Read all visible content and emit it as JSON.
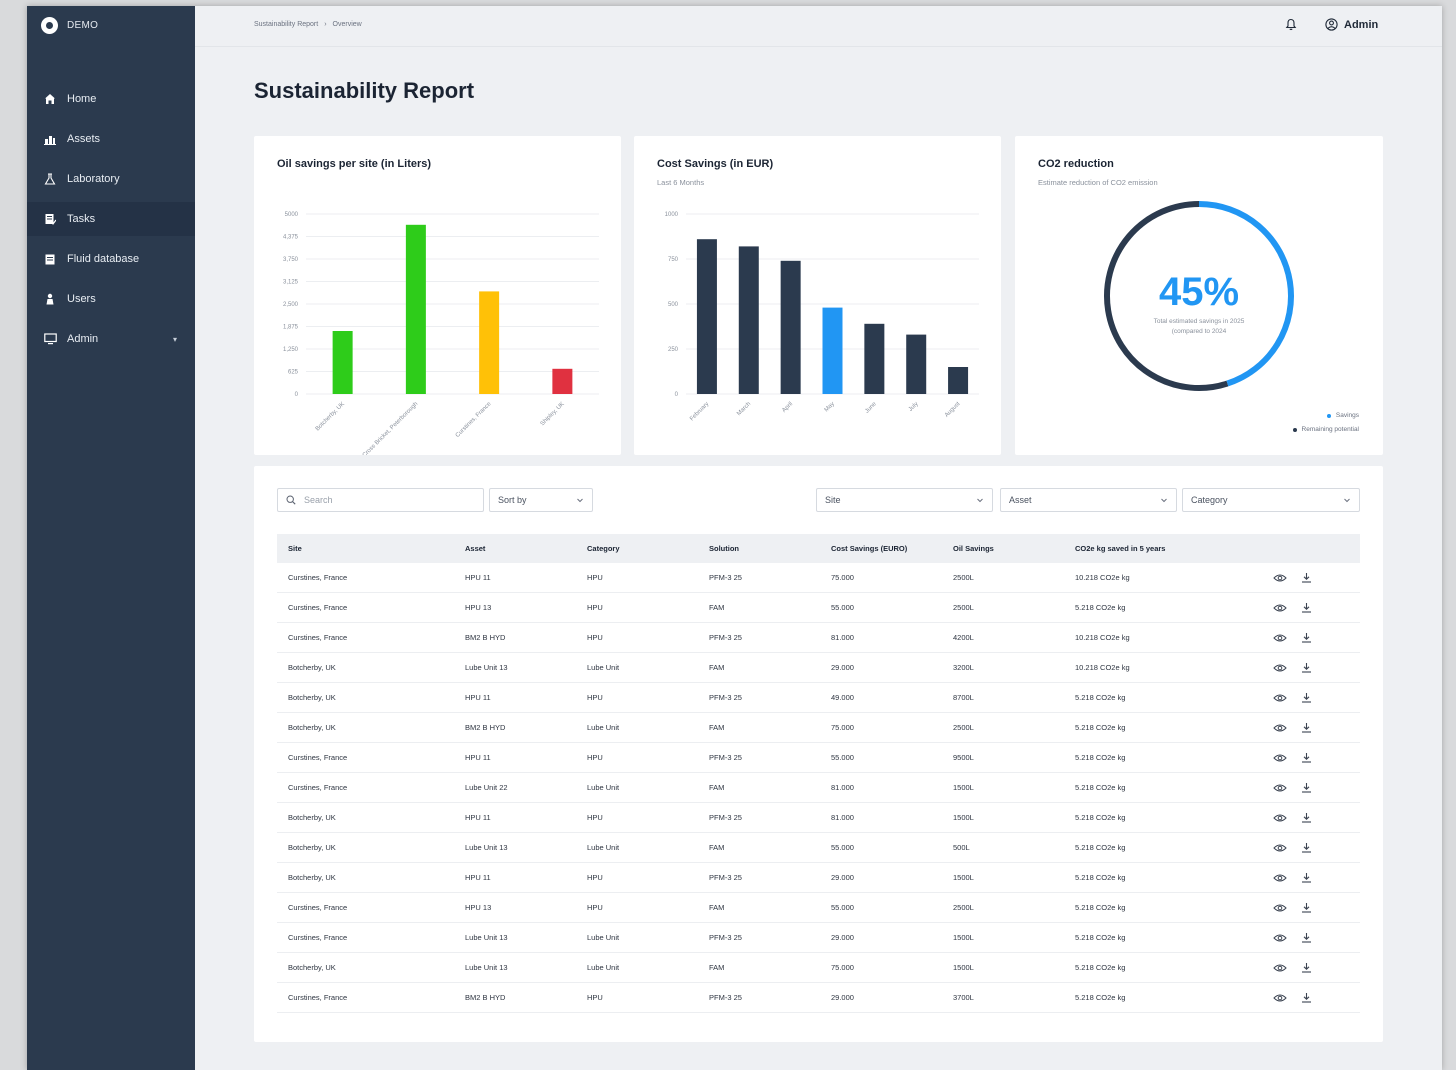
{
  "brand": {
    "name": "DEMO"
  },
  "sidebar": {
    "items": [
      {
        "label": "Home",
        "icon": "home-icon"
      },
      {
        "label": "Assets",
        "icon": "assets-icon"
      },
      {
        "label": "Laboratory",
        "icon": "flask-icon"
      },
      {
        "label": "Tasks",
        "icon": "tasks-icon"
      },
      {
        "label": "Fluid database",
        "icon": "database-icon"
      },
      {
        "label": "Users",
        "icon": "user-icon"
      },
      {
        "label": "Admin",
        "icon": "monitor-icon"
      }
    ],
    "active": "Tasks"
  },
  "breadcrumb": {
    "root": "Sustainability Report",
    "separator": "›",
    "current": "Overview"
  },
  "header": {
    "user": "Admin",
    "icons": [
      "bell-icon",
      "user-circle-icon"
    ]
  },
  "page": {
    "title": "Sustainability Report"
  },
  "colors": {
    "sidebar": "#2b3a4e",
    "accent_blue": "#2196f3",
    "navy": "#2b3a4e",
    "green": "#2ecc1a",
    "yellow": "#ffc107",
    "red": "#e03140"
  },
  "oil_card": {
    "title": "Oil savings per site (in Liters)"
  },
  "cost_card": {
    "title": "Cost Savings (in EUR)",
    "subtitle": "Last 6 Months"
  },
  "co2_card": {
    "title": "CO2 reduction",
    "subtitle": "Estimate reduction of CO2 emission",
    "percent_label": "45%",
    "caption_line1": "Total estimated savings in 2025",
    "caption_line2": "(compared to 2024",
    "legend_savings": "Savings",
    "legend_remaining": "Remaining potential"
  },
  "chart_data": [
    {
      "type": "bar",
      "title": "Oil savings per site (in Liters)",
      "categories": [
        "Botcherby, UK",
        "Cross Bricket, Peterborough",
        "Curstines, France",
        "Shipley, UK"
      ],
      "values": [
        1750,
        4700,
        2850,
        700
      ],
      "bar_colors": [
        "#2ecc1a",
        "#2ecc1a",
        "#ffc107",
        "#e03140"
      ],
      "ylim": [
        0,
        5000
      ],
      "yticks": [
        "0",
        "625",
        "1,250",
        "1,875",
        "2,500",
        "3,125",
        "3,750",
        "4,375",
        "5000"
      ],
      "grid": true
    },
    {
      "type": "bar",
      "title": "Cost Savings (in EUR)",
      "subtitle": "Last 6 Months",
      "categories": [
        "February",
        "March",
        "April",
        "May",
        "June",
        "July",
        "August"
      ],
      "values": [
        860,
        820,
        740,
        480,
        390,
        330,
        150
      ],
      "bar_colors": [
        "#2b3a4e",
        "#2b3a4e",
        "#2b3a4e",
        "#2196f3",
        "#2b3a4e",
        "#2b3a4e",
        "#2b3a4e"
      ],
      "ylim": [
        0,
        1000
      ],
      "yticks": [
        "0",
        "250",
        "500",
        "750",
        "1000"
      ],
      "grid": true
    },
    {
      "type": "pie",
      "title": "CO2 reduction",
      "labels": [
        "Savings",
        "Remaining potential"
      ],
      "values": [
        45,
        55
      ],
      "colors": [
        "#2196f3",
        "#2b3a4e"
      ]
    }
  ],
  "filters": {
    "search_placeholder": "Search",
    "sort_label": "Sort by",
    "site_label": "Site",
    "asset_label": "Asset",
    "category_label": "Category"
  },
  "table": {
    "columns": [
      "Site",
      "Asset",
      "Category",
      "Solution",
      "Cost Savings (EURO)",
      "Oil Savings",
      "CO2e kg saved in 5 years"
    ],
    "rows": [
      [
        "Curstines, France",
        "HPU 11",
        "HPU",
        "PFM-3 25",
        "75.000",
        "2500L",
        "10.218 CO2e kg"
      ],
      [
        "Curstines, France",
        "HPU 13",
        "HPU",
        "FAM",
        "55.000",
        "2500L",
        "5.218 CO2e kg"
      ],
      [
        "Curstines, France",
        "BM2 B HYD",
        "HPU",
        "PFM-3 25",
        "81.000",
        "4200L",
        "10.218 CO2e kg"
      ],
      [
        "Botcherby, UK",
        "Lube Unit 13",
        "Lube Unit",
        "FAM",
        "29.000",
        "3200L",
        "10.218 CO2e kg"
      ],
      [
        "Botcherby, UK",
        "HPU 11",
        "HPU",
        "PFM-3 25",
        "49.000",
        "8700L",
        "5.218 CO2e kg"
      ],
      [
        "Botcherby, UK",
        "BM2 B HYD",
        "Lube Unit",
        "FAM",
        "75.000",
        "2500L",
        "5.218 CO2e kg"
      ],
      [
        "Curstines, France",
        "HPU 11",
        "HPU",
        "PFM-3 25",
        "55.000",
        "9500L",
        "5.218 CO2e kg"
      ],
      [
        "Curstines, France",
        "Lube Unit 22",
        "Lube Unit",
        "FAM",
        "81.000",
        "1500L",
        "5.218 CO2e kg"
      ],
      [
        "Botcherby, UK",
        "HPU 11",
        "HPU",
        "PFM-3 25",
        "81.000",
        "1500L",
        "5.218 CO2e kg"
      ],
      [
        "Botcherby, UK",
        "Lube Unit 13",
        "Lube Unit",
        "FAM",
        "55.000",
        "500L",
        "5.218 CO2e kg"
      ],
      [
        "Botcherby, UK",
        "HPU 11",
        "HPU",
        "PFM-3 25",
        "29.000",
        "1500L",
        "5.218 CO2e kg"
      ],
      [
        "Curstines, France",
        "HPU 13",
        "HPU",
        "FAM",
        "55.000",
        "2500L",
        "5.218 CO2e kg"
      ],
      [
        "Curstines, France",
        "Lube Unit 13",
        "Lube Unit",
        "PFM-3 25",
        "29.000",
        "1500L",
        "5.218 CO2e kg"
      ],
      [
        "Botcherby, UK",
        "Lube Unit 13",
        "Lube Unit",
        "FAM",
        "75.000",
        "1500L",
        "5.218 CO2e kg"
      ],
      [
        "Curstines, France",
        "BM2 B HYD",
        "HPU",
        "PFM-3 25",
        "29.000",
        "3700L",
        "5.218 CO2e kg"
      ]
    ],
    "row_action_icons": [
      "eye-icon",
      "download-icon"
    ]
  }
}
